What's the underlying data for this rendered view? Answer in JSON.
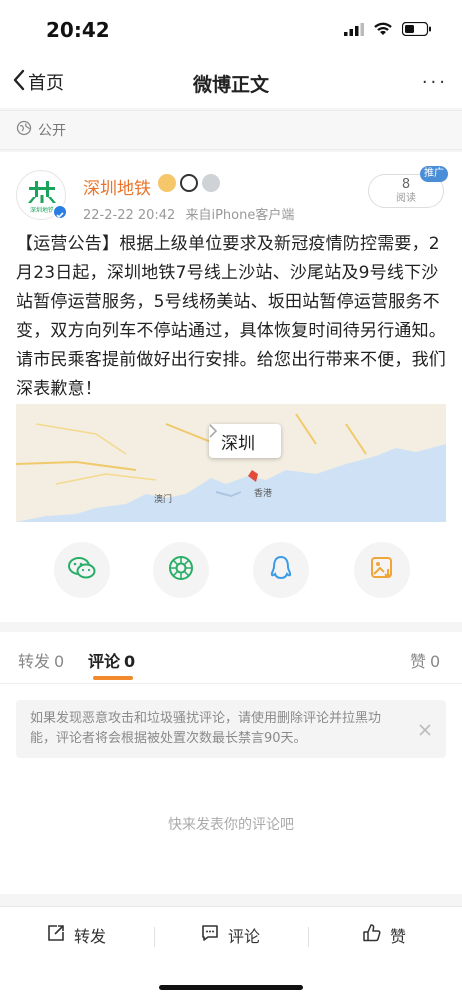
{
  "status_bar": {
    "time": "20:42"
  },
  "nav": {
    "back_label": "首页",
    "title": "微博正文",
    "more_label": "···"
  },
  "visibility": {
    "label": "公开"
  },
  "post": {
    "author": "深圳地铁",
    "avatar_text": "深圳地铁",
    "date": "22-2-22 20:42",
    "source": "来自iPhone客户端",
    "read_count": "8",
    "read_label": "阅读",
    "promo_label": "推广",
    "body": "【运营公告】根据上级单位要求及新冠疫情防控需要，2月23日起，深圳地铁7号线上沙站、沙尾站及9号线下沙站暂停运营服务，5号线杨美站、坂田站暂停运营服务不变，双方向列车不停站通过，具体恢复时间待另行通知。请市民乘客提前做好出行安排。给您出行带来不便，我们深表歉意！",
    "map": {
      "city": "深圳",
      "labels": {
        "macau": "澳门",
        "hongkong": "香港"
      }
    }
  },
  "share_icons": [
    "wechat-icon",
    "moments-icon",
    "qq-icon",
    "save-image-icon"
  ],
  "tabs": [
    {
      "label": "转发",
      "count": "0"
    },
    {
      "label": "评论",
      "count": "0"
    },
    {
      "label": "赞",
      "count": "0"
    }
  ],
  "comments": {
    "notice": "如果发现恶意攻击和垃圾骚扰评论，请使用删除评论并拉黑功能，评论者将会根据被处置次数最长禁言90天。",
    "empty_text": "快来发表你的评论吧"
  },
  "actions": {
    "repost": "转发",
    "comment": "评论",
    "like": "赞"
  },
  "colors": {
    "accent": "#f08a2c",
    "username": "#e8742b",
    "verified": "#2a7ee3",
    "metro_green": "#1aa35a"
  }
}
